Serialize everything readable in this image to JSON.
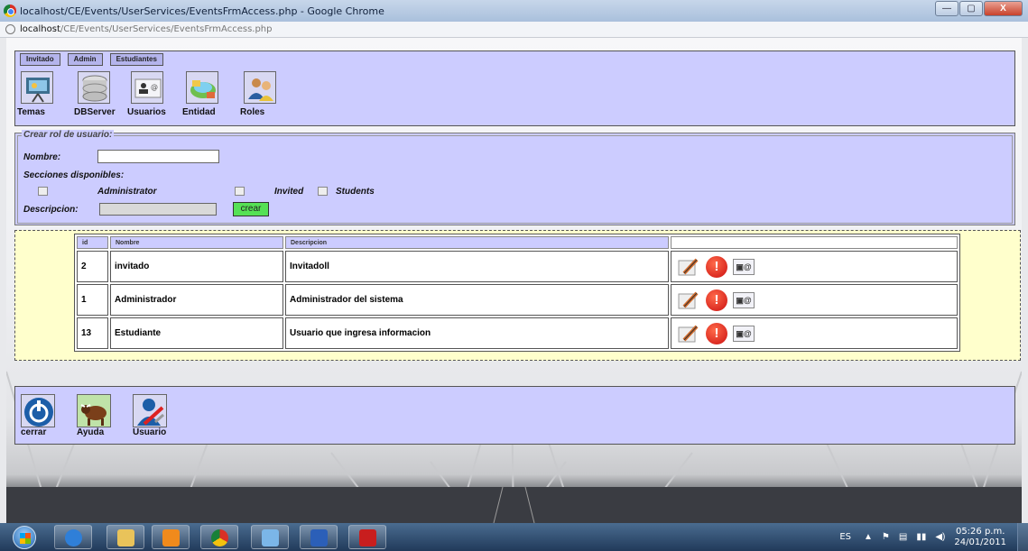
{
  "window": {
    "title": "localhost/CE/Events/UserServices/EventsFrmAccess.php - Google Chrome",
    "controls": [
      "—",
      "▢",
      "X"
    ]
  },
  "address_bar": {
    "host": "localhost",
    "path": "/CE/Events/UserServices/EventsFrmAccess.php"
  },
  "tabs": [
    "Invitado",
    "Admin",
    "Estudiantes"
  ],
  "toolbar": [
    {
      "label": "Temas",
      "icon": "presentation-board-icon"
    },
    {
      "label": "DBServer",
      "icon": "database-icon"
    },
    {
      "label": "Usuarios",
      "icon": "contact-card-icon"
    },
    {
      "label": "Entidad",
      "icon": "network-globe-icon"
    },
    {
      "label": "Roles",
      "icon": "users-group-icon"
    }
  ],
  "form": {
    "legend": "Crear rol de usuario:",
    "nombre_label": "Nombre:",
    "nombre_value": "",
    "secciones_label": "Secciones disponibles:",
    "sections": [
      {
        "label": "Administrator",
        "checked": false
      },
      {
        "label": "Invited",
        "checked": false
      },
      {
        "label": "Students",
        "checked": false
      }
    ],
    "descripcion_label": "Descripcion:",
    "descripcion_value": "",
    "submit_label": "crear"
  },
  "table": {
    "headers": [
      "id",
      "Nombre",
      "Descripcion",
      ""
    ],
    "rows": [
      {
        "id": "2",
        "nombre": "invitado",
        "descripcion": "Invitadoll"
      },
      {
        "id": "1",
        "nombre": "Administrador",
        "descripcion": "Administrador del sistema"
      },
      {
        "id": "13",
        "nombre": "Estudiante",
        "descripcion": "Usuario que ingresa informacion"
      }
    ],
    "row_actions": [
      "edit-icon",
      "delete-warning-icon",
      "user-card-icon"
    ]
  },
  "bottom_toolbar": [
    {
      "label": "cerrar",
      "icon": "power-icon"
    },
    {
      "label": "Ayuda",
      "icon": "bull-icon"
    },
    {
      "label": "Usuario",
      "icon": "user-tools-icon"
    }
  ],
  "taskbar": {
    "apps": [
      "internet-explorer-icon",
      "file-explorer-icon",
      "media-player-icon",
      "chrome-icon",
      "paint-icon",
      "word-icon",
      "acrobat-icon"
    ],
    "language": "ES",
    "time": "05:26 p.m.",
    "date": "24/01/2011"
  },
  "colors": {
    "panel": "#ccccff",
    "table_area": "#ffffcc",
    "submit_button": "#55e155",
    "warning": "#cc1010"
  }
}
